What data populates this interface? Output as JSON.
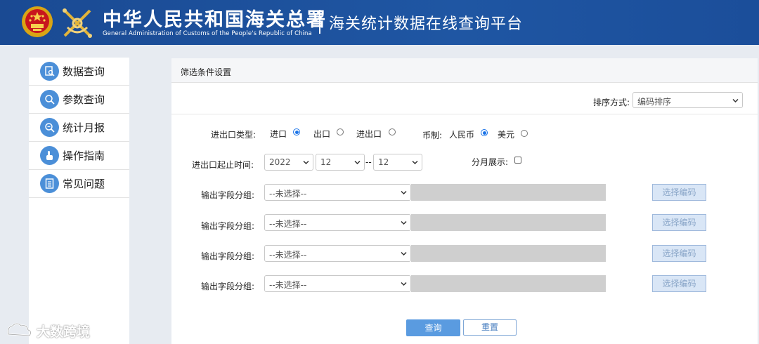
{
  "header": {
    "org_name_cn": "中华人民共和国海关总署",
    "org_name_en": "General Administration of Customs of the People's Republic of China",
    "platform_title": "海关统计数据在线查询平台"
  },
  "sidebar": {
    "items": [
      {
        "label": "数据查询",
        "icon": "document-search-icon"
      },
      {
        "label": "参数查询",
        "icon": "magnifier-icon"
      },
      {
        "label": "统计月报",
        "icon": "report-search-icon"
      },
      {
        "label": "操作指南",
        "icon": "hand-pointer-icon"
      },
      {
        "label": "常见问题",
        "icon": "list-document-icon"
      }
    ]
  },
  "panel": {
    "title": "筛选条件设置",
    "sort_label": "排序方式:",
    "sort_value": "编码排序",
    "trade_type_label": "进出口类型:",
    "trade_options": [
      {
        "label": "进口",
        "selected": true
      },
      {
        "label": "出口",
        "selected": false
      },
      {
        "label": "进出口",
        "selected": false
      }
    ],
    "currency_label": "币制:",
    "currency_options": [
      {
        "label": "人民币",
        "selected": true
      },
      {
        "label": "美元",
        "selected": false
      }
    ],
    "period_label": "进出口起止时间:",
    "year": "2022",
    "start_month": "12",
    "range_separator": "--",
    "end_month": "12",
    "monthly_label": "分月展示:",
    "monthly_checked": false,
    "field_groups": [
      {
        "label": "输出字段分组:",
        "value": "--未选择--",
        "button": "选择编码"
      },
      {
        "label": "输出字段分组:",
        "value": "--未选择--",
        "button": "选择编码"
      },
      {
        "label": "输出字段分组:",
        "value": "--未选择--",
        "button": "选择编码"
      },
      {
        "label": "输出字段分组:",
        "value": "--未选择--",
        "button": "选择编码"
      }
    ],
    "query_button": "查询",
    "reset_button": "重置"
  },
  "watermark": {
    "text": "大数跨境"
  },
  "colors": {
    "header_bg": "#1d4f98",
    "sidebar_icon": "#4b8fd8",
    "primary_button": "#5a9be0",
    "radio_selected": "#1a73e8"
  }
}
